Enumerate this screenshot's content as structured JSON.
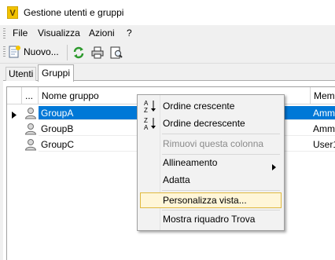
{
  "window": {
    "title": "Gestione utenti e gruppi",
    "icon": "app-v-icon"
  },
  "menu": {
    "items": [
      {
        "label": "File"
      },
      {
        "label": "Visualizza"
      },
      {
        "label": "Azioni"
      },
      {
        "label": "?"
      }
    ]
  },
  "toolbar": {
    "new_label": "Nuovo...",
    "icons": [
      "new-document-icon",
      "refresh-icon",
      "print-icon",
      "print-preview-icon"
    ]
  },
  "tabs": [
    {
      "label": "Utenti",
      "active": false
    },
    {
      "label": "Gruppi",
      "active": true
    }
  ],
  "grid": {
    "columns": [
      {
        "label": "..."
      },
      {
        "label": "Nome gruppo"
      },
      {
        "label": "Mem"
      }
    ],
    "rows": [
      {
        "name": "GroupA",
        "member": "Amm",
        "selected": true
      },
      {
        "name": "GroupB",
        "member": "Amm",
        "selected": false
      },
      {
        "name": "GroupC",
        "member": "User1",
        "selected": false
      }
    ]
  },
  "context_menu": {
    "items": [
      {
        "label": "Ordine crescente",
        "icon": "sort-ascending-icon",
        "enabled": true
      },
      {
        "label": "Ordine decrescente",
        "icon": "sort-descending-icon",
        "enabled": true
      },
      {
        "label": "Rimuovi questa colonna",
        "enabled": false
      },
      {
        "label": "Allineamento",
        "submenu": true,
        "enabled": true
      },
      {
        "label": "Adatta",
        "enabled": true
      },
      {
        "label": "Personalizza vista...",
        "enabled": true,
        "highlighted": true
      },
      {
        "label": "Mostra riquadro Trova",
        "enabled": true
      }
    ]
  },
  "colors": {
    "selection": "#0078d7",
    "hover_fill": "#fff6d8",
    "hover_border": "#e0b940",
    "app_icon": "#f2c200"
  }
}
